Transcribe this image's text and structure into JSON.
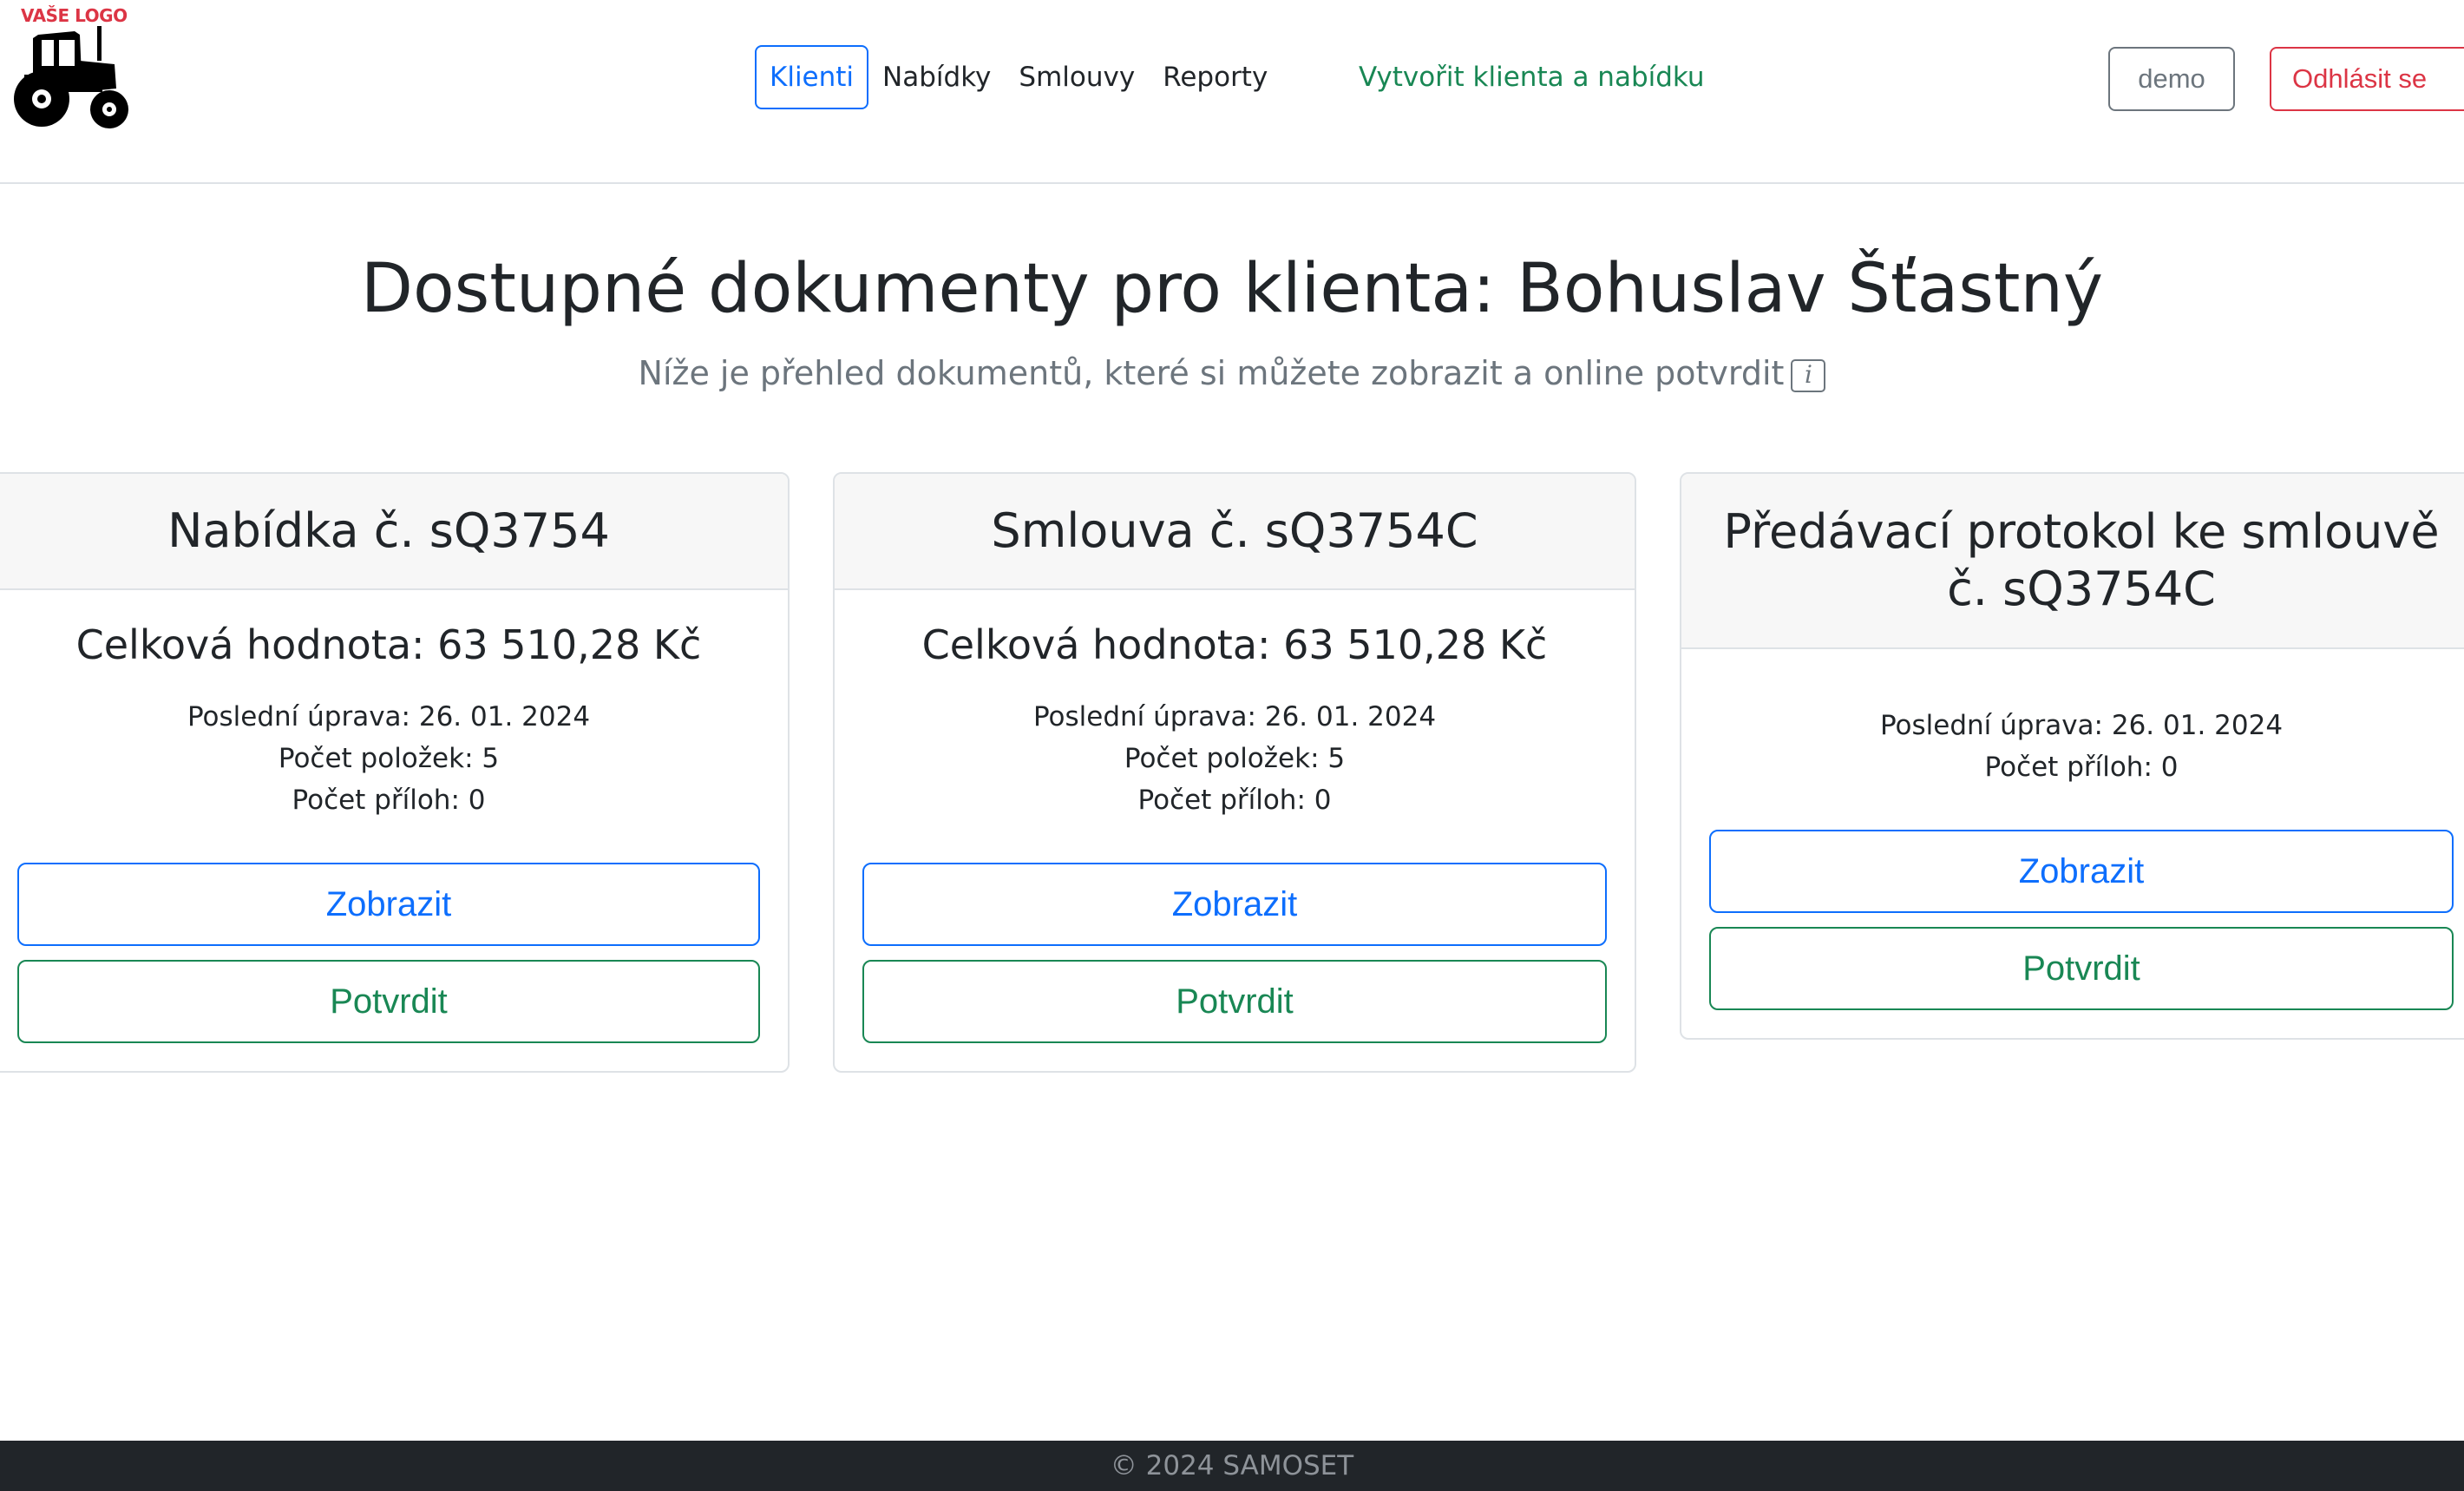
{
  "logo": {
    "text": "VAŠE LOGO"
  },
  "nav": {
    "items": [
      {
        "label": "Klienti",
        "active": true
      },
      {
        "label": "Nabídky",
        "active": false
      },
      {
        "label": "Smlouvy",
        "active": false
      },
      {
        "label": "Reporty",
        "active": false
      }
    ],
    "create_label": "Vytvořit klienta a nabídku",
    "user_label": "demo",
    "logout_label": "Odhlásit se"
  },
  "page": {
    "title": "Dostupné dokumenty pro klienta: Bohuslav Šťastný",
    "subtitle": "Níže je přehled dokumentů, které si můžete zobrazit a online potvrdit",
    "info_icon": "i"
  },
  "documents": [
    {
      "title": "Nabídka č. sQ3754",
      "total": "Celková hodnota: 63 510,28 Kč",
      "last_modified": "Poslední úprava: 26. 01. 2024",
      "items_count": "Počet položek: 5",
      "attachments_count": "Počet příloh: 0",
      "view_label": "Zobrazit",
      "confirm_label": "Potvrdit"
    },
    {
      "title": "Smlouva č. sQ3754C",
      "total": "Celková hodnota: 63 510,28 Kč",
      "last_modified": "Poslední úprava: 26. 01. 2024",
      "items_count": "Počet položek: 5",
      "attachments_count": "Počet příloh: 0",
      "view_label": "Zobrazit",
      "confirm_label": "Potvrdit"
    },
    {
      "title": "Předávací protokol ke smlouvě č. sQ3754C",
      "last_modified": "Poslední úprava: 26. 01. 2024",
      "attachments_count": "Počet příloh: 0",
      "view_label": "Zobrazit",
      "confirm_label": "Potvrdit"
    }
  ],
  "footer": {
    "text": "© 2024 SAMOSET"
  },
  "colors": {
    "primary": "#0d6efd",
    "success": "#198754",
    "danger": "#dc3545",
    "secondary": "#6c757d",
    "footer_bg": "#212529"
  }
}
